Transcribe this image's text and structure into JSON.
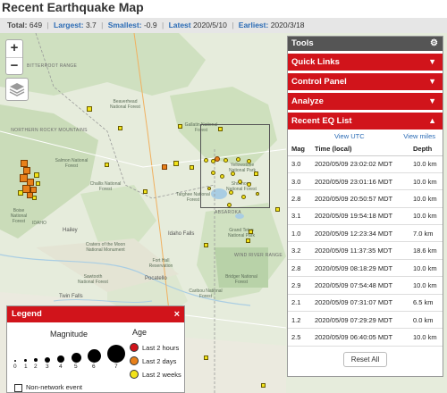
{
  "page_title": "Recent Earthquake Map",
  "stats": {
    "total_label": "Total:",
    "total_value": "649",
    "largest_label": "Largest:",
    "largest_value": "3.7",
    "smallest_label": "Smallest:",
    "smallest_value": "-0.9",
    "latest_label": "Latest",
    "latest_value": "2020/5/10",
    "earliest_label": "Earliest:",
    "earliest_value": "2020/3/18"
  },
  "map": {
    "zoom_in": "+",
    "zoom_out": "−",
    "labels": {
      "tetons": "ABSAROKA",
      "wind_river": "WIND RIVER RANGE",
      "idaho_falls": "Idaho Falls",
      "pocatello": "Pocatello",
      "twin_falls": "Twin Falls",
      "hailey": "Hailey",
      "idaho": "IDAHO",
      "idaho_range": "BITTERROOT RANGE",
      "rocky": "NORTHERN ROCKY MOUNTAINS",
      "yellowstone": "Yellowstone National Park",
      "craters": "Craters of the Moon National Monument",
      "fort_hall": "Fort Hall Reservation",
      "bridger": "Bridger National Forest",
      "caribou": "Caribou National Forest",
      "sawtooth": "Sawtooth National Forest",
      "salmon": "Salmon National Forest",
      "beaverhead": "Beaverhead National Forest",
      "targhee": "Targhee National Forest",
      "gallatin": "Gallatin National Forest",
      "shoshone": "Shoshone National Forest",
      "grand_teton": "Grand Teton National Park",
      "boise": "Boise National Forest",
      "challis": "Challis National Forest"
    }
  },
  "tools": {
    "title": "Tools",
    "quick_links": "Quick Links",
    "control_panel": "Control Panel",
    "analyze": "Analyze",
    "recent_list": "Recent EQ List",
    "view_utc": "View UTC",
    "view_miles": "View miles",
    "columns": [
      "Mag",
      "Time (local)",
      "Depth"
    ],
    "rows": [
      [
        "3.0",
        "2020/05/09 23:02:02 MDT",
        "10.0 km"
      ],
      [
        "3.0",
        "2020/05/09 23:01:16 MDT",
        "10.0 km"
      ],
      [
        "2.8",
        "2020/05/09 20:50:57 MDT",
        "10.0 km"
      ],
      [
        "3.1",
        "2020/05/09 19:54:18 MDT",
        "10.0 km"
      ],
      [
        "1.0",
        "2020/05/09 12:23:34 MDT",
        "7.0 km"
      ],
      [
        "3.2",
        "2020/05/09 11:37:35 MDT",
        "18.6 km"
      ],
      [
        "2.8",
        "2020/05/09 08:18:29 MDT",
        "10.0 km"
      ],
      [
        "2.9",
        "2020/05/09 07:54:48 MDT",
        "10.0 km"
      ],
      [
        "2.1",
        "2020/05/09 07:31:07 MDT",
        "6.5 km"
      ],
      [
        "1.2",
        "2020/05/09 07:29:29 MDT",
        "0.0 km"
      ],
      [
        "2.5",
        "2020/05/09 06:40:05 MDT",
        "10.0 km"
      ]
    ],
    "reset": "Reset All"
  },
  "legend": {
    "title": "Legend",
    "close": "×",
    "magnitude": "Magnitude",
    "age": "Age",
    "mag_values": [
      "0",
      "1",
      "2",
      "3",
      "4",
      "5",
      "6",
      "7"
    ],
    "ages": [
      {
        "label": "Last 2 hours",
        "color": "#d1141b"
      },
      {
        "label": "Last 2 days",
        "color": "#e8801a"
      },
      {
        "label": "Last 2 weeks",
        "color": "#f2e31a"
      }
    ],
    "non_network": "Non-network event"
  },
  "colors": {
    "accent": "#d1141b",
    "link": "#2a6bb5",
    "panel_header": "#555555"
  }
}
